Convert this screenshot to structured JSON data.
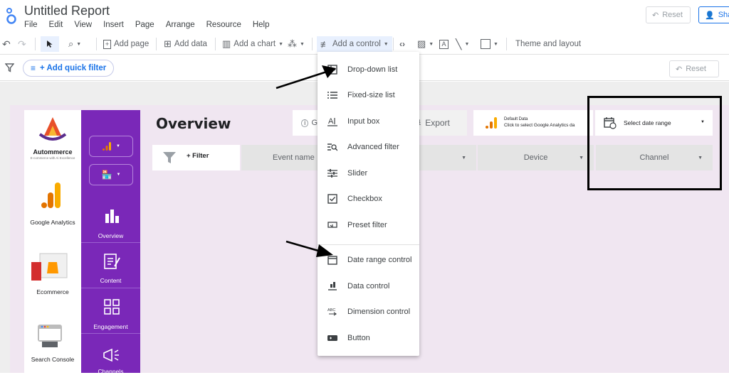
{
  "app": {
    "title": "Untitled Report",
    "menu": [
      "File",
      "Edit",
      "View",
      "Insert",
      "Page",
      "Arrange",
      "Resource",
      "Help"
    ],
    "reset_label": "Reset",
    "share_label": "Sha"
  },
  "toolbar": {
    "add_page": "Add page",
    "add_data": "Add data",
    "add_chart": "Add a chart",
    "add_control": "Add a control",
    "theme": "Theme and layout"
  },
  "filterbar": {
    "quick_filter": "+ Add quick filter",
    "reset_label": "Reset"
  },
  "report": {
    "logo_name": "Autommerce",
    "logo_tagline": "E-commerce with Ai Excellence",
    "side_items": [
      "Google Analytics",
      "Ecommerce",
      "Search Console"
    ],
    "nav_items": [
      "Overview",
      "Content",
      "Engagement",
      "Channels"
    ],
    "title": "Overview",
    "export_label": "Export",
    "g_label": "G",
    "datasource_title": "Default Data",
    "datasource_sub": "Click to select Google Analytics da",
    "date_range": "Select date range",
    "filter_label": "+ Filter",
    "dropdowns": [
      "Event name",
      "Device",
      "Channel"
    ]
  },
  "control_menu": {
    "items": [
      {
        "label": "Drop-down list",
        "icon": "dropdown-list-icon"
      },
      {
        "label": "Fixed-size list",
        "icon": "list-icon"
      },
      {
        "label": "Input box",
        "icon": "input-box-icon"
      },
      {
        "label": "Advanced filter",
        "icon": "advanced-filter-icon"
      },
      {
        "label": "Slider",
        "icon": "slider-icon"
      },
      {
        "label": "Checkbox",
        "icon": "checkbox-icon"
      },
      {
        "label": "Preset filter",
        "icon": "preset-filter-icon"
      },
      {
        "label": "Date range control",
        "icon": "calendar-icon"
      },
      {
        "label": "Data control",
        "icon": "data-control-icon"
      },
      {
        "label": "Dimension control",
        "icon": "dimension-control-icon"
      },
      {
        "label": "Button",
        "icon": "button-icon"
      }
    ]
  },
  "colors": {
    "accent": "#1a73e8",
    "nav_purple": "#7a28b8",
    "page_bg": "#f0e6f1",
    "analytics_orange": "#f9ab00"
  }
}
